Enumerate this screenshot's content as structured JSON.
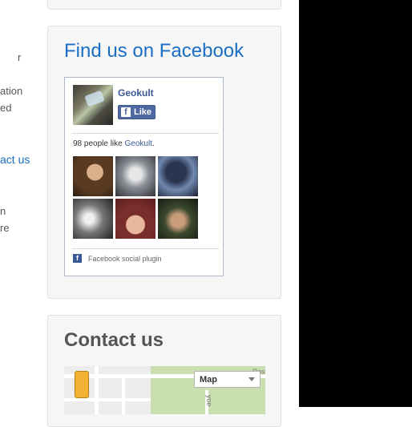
{
  "left_fragments": [
    "r",
    "ation",
    "ed",
    "act us",
    "n",
    "re"
  ],
  "find_us": {
    "title": "Find us on Facebook",
    "page_name": "Geokult",
    "like_label": "Like",
    "like_glyph": "f",
    "count_prefix": "98 people like ",
    "count_link": "Geokult",
    "count_suffix": ".",
    "footer": "Facebook social plugin"
  },
  "contact": {
    "title": "Contact us",
    "map_type": "Map",
    "street_fragments": [
      "yoe",
      "Post"
    ]
  },
  "colors": {
    "accent": "#1a6fc4",
    "facebook_blue": "#3b5998",
    "card_bg": "#f6f6f6"
  }
}
